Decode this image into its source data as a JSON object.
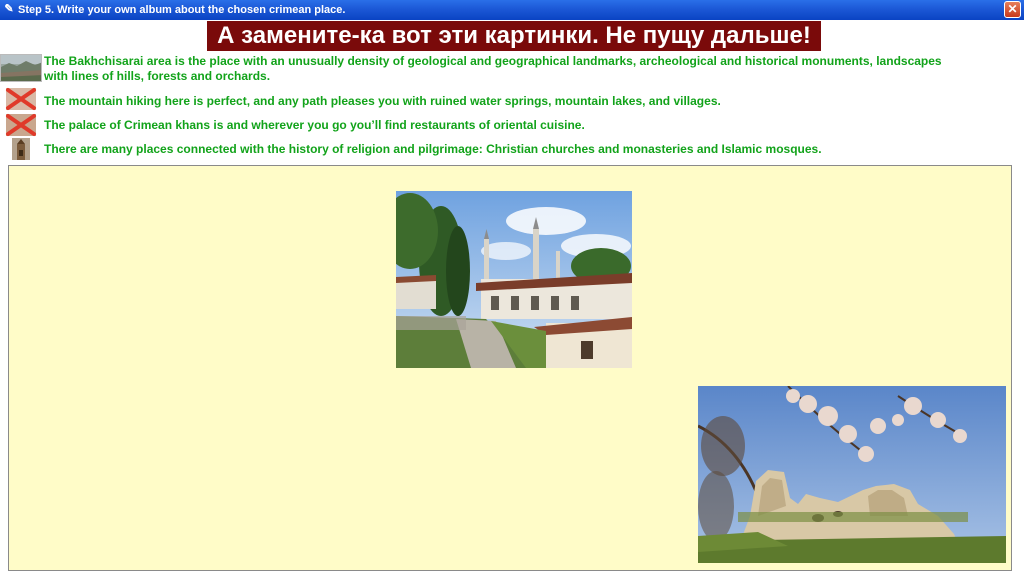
{
  "window": {
    "title": "Step 5. Write your own album about the chosen crimean place.",
    "close_glyph": "✕"
  },
  "banner": {
    "text": "А замените-ка вот эти картинки. Не пущу дальше!"
  },
  "rows": [
    {
      "text": "The Bakhchisarai area is the place with an unusually density of geological and geographical landmarks, archeological and historical monuments, landscapes with lines of hills, forests and orchards.",
      "icon": "landscape-thumbnail"
    },
    {
      "text": "The mountain hiking here is perfect, and any path pleases you with ruined water springs, mountain lakes, and villages.",
      "icon": "broken-image-icon"
    },
    {
      "text": "The palace of Crimean khans is and wherever you go you’ll find restaurants of oriental cuisine.",
      "icon": "broken-image-icon"
    },
    {
      "text": "There are many places connected with the history of religion and pilgrimage: Christian churches and monasteries and Islamic mosques.",
      "icon": "church-thumbnail"
    }
  ],
  "colors": {
    "titlebar": "#1c58d6",
    "banner_bg": "#7a0a0a",
    "row_text": "#12a31a",
    "album_bg": "#fffcc8"
  },
  "album": {
    "photos": [
      {
        "subject": "khan-palace-photo"
      },
      {
        "subject": "cave-city-rocks-photo"
      }
    ]
  }
}
